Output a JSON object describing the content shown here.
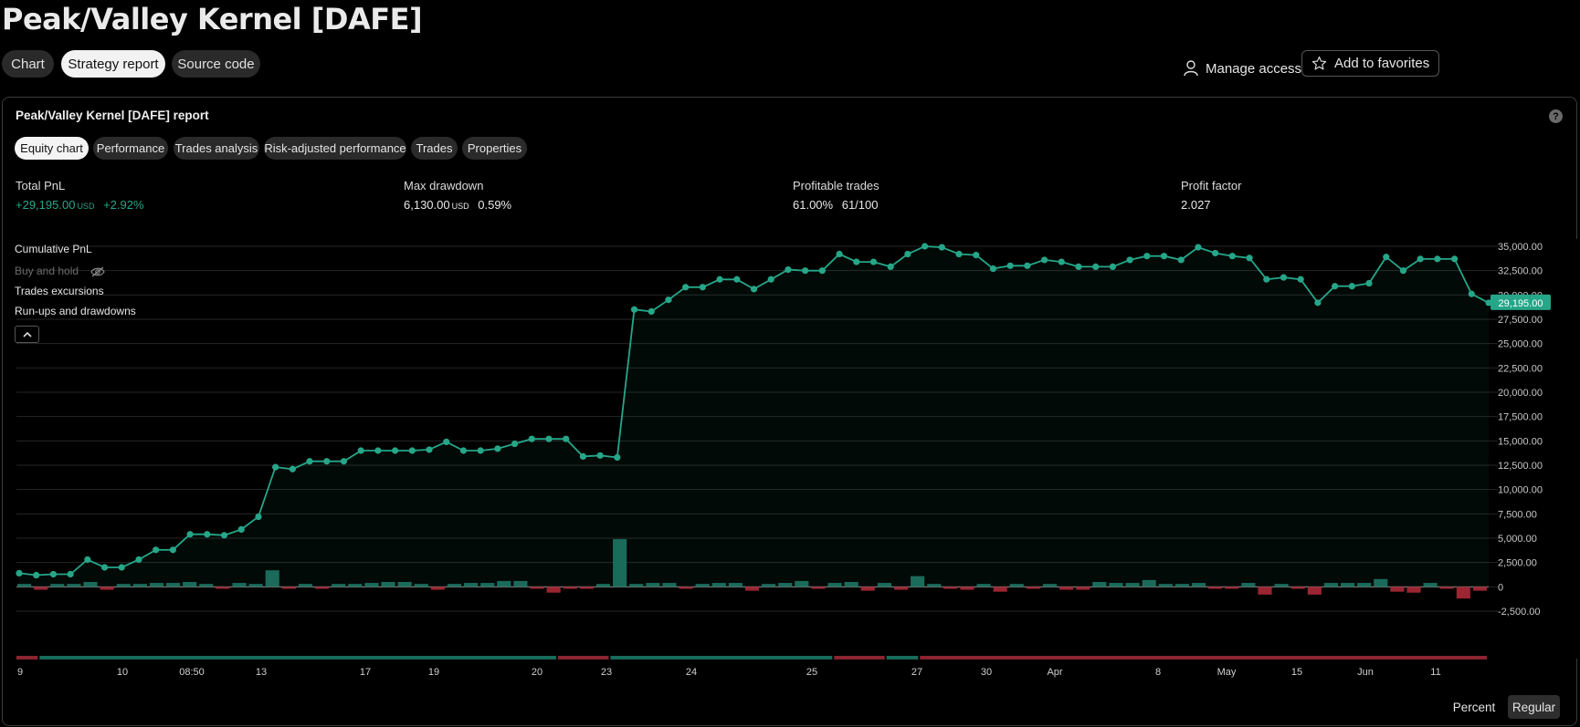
{
  "page": {
    "title": "Peak/Valley Kernel [DAFE]",
    "tabs": [
      "Chart",
      "Strategy report",
      "Source code"
    ],
    "manage_access": "Manage access",
    "add_favorites": "Add to favorites"
  },
  "report": {
    "title": "Peak/Valley Kernel [DAFE] report",
    "help": "?",
    "tabs": [
      "Equity chart",
      "Performance",
      "Trades analysis",
      "Risk-adjusted performance",
      "Trades",
      "Properties"
    ],
    "stats": {
      "total_pnl": {
        "label": "Total PnL",
        "value": "+29,195.00",
        "currency": "USD",
        "pct": "+2.92%"
      },
      "max_drawdown": {
        "label": "Max drawdown",
        "value": "6,130.00",
        "currency": "USD",
        "pct": "0.59%"
      },
      "profitable_trades": {
        "label": "Profitable trades",
        "pct": "61.00%",
        "ratio": "61/100"
      },
      "profit_factor": {
        "label": "Profit factor",
        "value": "2.027"
      }
    },
    "legend": [
      "Cumulative PnL",
      "Buy and hold",
      "Trades excursions",
      "Run-ups and drawdowns"
    ],
    "collapse_icon": "chevron-up-icon",
    "bottom": {
      "percent": "Percent",
      "regular": "Regular"
    }
  },
  "colors": {
    "accent": "#26a688",
    "negative": "#b22f3b",
    "background": "#000000"
  },
  "chart_data": {
    "type": "line",
    "title": "",
    "ylim": [
      -2500,
      35000
    ],
    "y_ticks": [
      "35,000.00",
      "32,500.00",
      "30,000.00",
      "27,500.00",
      "25,000.00",
      "22,500.00",
      "20,000.00",
      "17,500.00",
      "15,000.00",
      "12,500.00",
      "10,000.00",
      "7,500.00",
      "5,000.00",
      "2,500.00",
      "0",
      "-2,500.00"
    ],
    "x_ticks": [
      "9",
      "10",
      "08:50",
      "13",
      "17",
      "19",
      "20",
      "23",
      "24",
      "25",
      "27",
      "30",
      "Apr",
      "8",
      "May",
      "15",
      "Jun",
      "11"
    ],
    "last_value_label": "29,195.00",
    "series": [
      {
        "values": [
          1400,
          1200,
          1300,
          1300,
          2800,
          2000,
          2000,
          2800,
          3800,
          3800,
          5400,
          5400,
          5300,
          5900,
          7200,
          12300,
          12100,
          12900,
          12900,
          12900,
          14000,
          14000,
          14000,
          14000,
          14100,
          14900,
          14000,
          14000,
          14200,
          14700,
          15200,
          15200,
          15200,
          13400,
          13500,
          13300,
          28500,
          28300,
          29500,
          30800,
          30800,
          31600,
          31600,
          30600,
          31600,
          32600,
          32500,
          32500,
          34200,
          33400,
          33400,
          32900,
          34200,
          35000,
          34900,
          34200,
          34100,
          32700,
          33000,
          33000,
          33600,
          33400,
          32900,
          32900,
          32900,
          33600,
          34000,
          34000,
          33600,
          34900,
          34300,
          34000,
          33800,
          31600,
          31800,
          31600,
          29200,
          30900,
          30900,
          31200,
          33900,
          32500,
          33700,
          33700,
          33700,
          30100,
          29195
        ]
      }
    ],
    "bars": [
      300,
      -300,
      300,
      300,
      500,
      -300,
      300,
      300,
      400,
      400,
      500,
      300,
      -200,
      400,
      300,
      1700,
      -200,
      300,
      -200,
      300,
      300,
      400,
      500,
      500,
      300,
      -300,
      300,
      400,
      400,
      600,
      600,
      -200,
      -600,
      -200,
      -200,
      300,
      4900,
      300,
      400,
      400,
      -200,
      300,
      400,
      400,
      -400,
      300,
      400,
      600,
      -200,
      400,
      500,
      -400,
      400,
      -300,
      1100,
      300,
      -200,
      -300,
      300,
      -500,
      300,
      -200,
      300,
      -300,
      -300,
      500,
      400,
      400,
      700,
      300,
      300,
      400,
      -200,
      -200,
      400,
      -800,
      300,
      -200,
      -800,
      400,
      400,
      400,
      800,
      -500,
      -600,
      400,
      -200,
      -1200,
      -400
    ],
    "trade_strip": [
      {
        "from": 0,
        "to": 0.0157,
        "color": "negative"
      },
      {
        "from": 0.0157,
        "to": 0.3678,
        "color": "positive"
      },
      {
        "from": 0.3678,
        "to": 0.4035,
        "color": "negative"
      },
      {
        "from": 0.4035,
        "to": 0.5554,
        "color": "positive"
      },
      {
        "from": 0.5554,
        "to": 0.591,
        "color": "negative"
      },
      {
        "from": 0.591,
        "to": 0.6137,
        "color": "positive"
      },
      {
        "from": 0.6137,
        "to": 1.0,
        "color": "negative"
      }
    ]
  }
}
